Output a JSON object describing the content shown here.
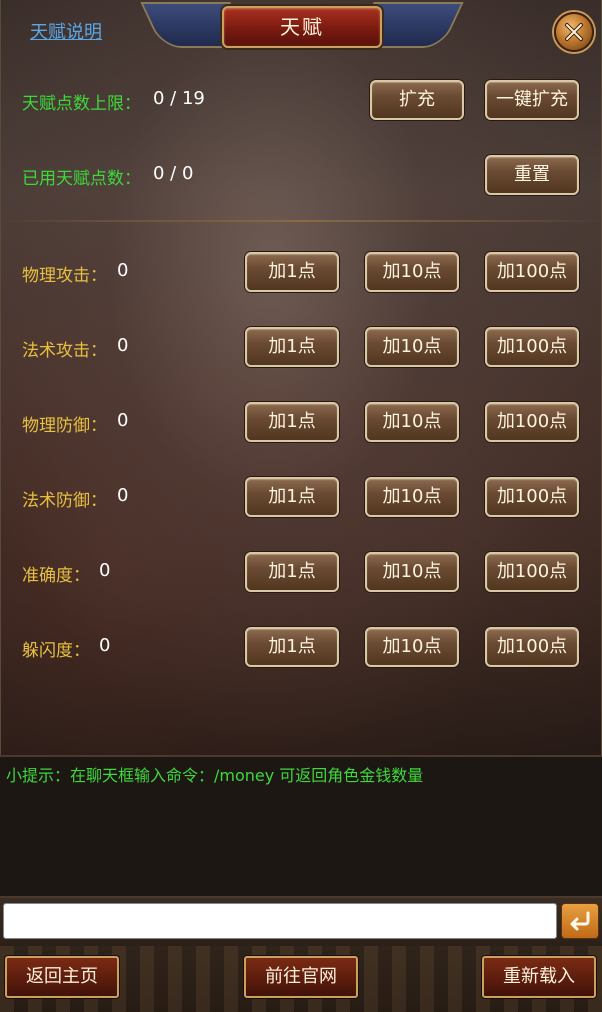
{
  "header": {
    "title": "天赋",
    "help_link": "天赋说明"
  },
  "points": {
    "limit_label": "天赋点数上限：",
    "limit_value": "0 / 19",
    "expand_label": "扩充",
    "expand_all_label": "一键扩充",
    "used_label": "已用天赋点数：",
    "used_value": "0 / 0",
    "reset_label": "重置"
  },
  "stats": [
    {
      "label": "物理攻击：",
      "value": "0",
      "add1": "加1点",
      "add10": "加10点",
      "add100": "加100点"
    },
    {
      "label": "法术攻击：",
      "value": "0",
      "add1": "加1点",
      "add10": "加10点",
      "add100": "加100点"
    },
    {
      "label": "物理防御：",
      "value": "0",
      "add1": "加1点",
      "add10": "加10点",
      "add100": "加100点"
    },
    {
      "label": "法术防御：",
      "value": "0",
      "add1": "加1点",
      "add10": "加10点",
      "add100": "加100点"
    },
    {
      "label": "准确度：",
      "value": "0",
      "add1": "加1点",
      "add10": "加10点",
      "add100": "加100点"
    },
    {
      "label": "躲闪度：",
      "value": "0",
      "add1": "加1点",
      "add10": "加10点",
      "add100": "加100点"
    }
  ],
  "tip": {
    "text": "小提示：在聊天框输入命令：/money 可返回角色金钱数量"
  },
  "chat": {
    "value": "",
    "send_icon": "return-arrow-icon"
  },
  "footer": {
    "home_label": "返回主页",
    "official_label": "前往官网",
    "reload_label": "重新载入"
  },
  "colors": {
    "label_green": "#3ed83a",
    "label_gold": "#e8c040",
    "link_blue": "#5aa8e8"
  }
}
